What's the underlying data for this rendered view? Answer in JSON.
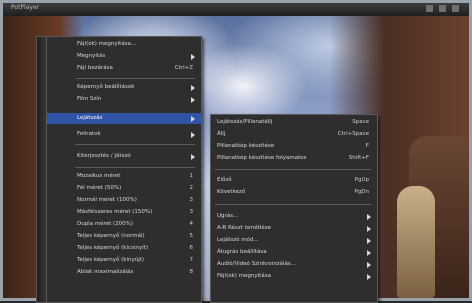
{
  "window": {
    "title": "PotPlayer"
  },
  "main_menu": {
    "items": [
      {
        "label": "Fájl(ok) megnyitása...",
        "key": "",
        "arrow": false
      },
      {
        "label": "Megnyitás",
        "key": "",
        "arrow": true
      },
      {
        "label": "Fájl bezárása",
        "key": "Ctrl+Z",
        "arrow": false
      },
      {
        "label": "Képernyő beállítások",
        "key": "",
        "arrow": true
      },
      {
        "label": "Film Szín",
        "key": "",
        "arrow": true
      },
      {
        "label": "Lejátszás",
        "key": "",
        "arrow": true
      },
      {
        "label": "Feliratok",
        "key": "",
        "arrow": true
      },
      {
        "label": "Kiterjesztés / Játszó",
        "key": "",
        "arrow": true
      },
      {
        "label": "Mozaikus méret",
        "key": "1",
        "arrow": false
      },
      {
        "label": "Fél méret (50%)",
        "key": "2",
        "arrow": false
      },
      {
        "label": "Normál méret (100%)",
        "key": "3",
        "arrow": false
      },
      {
        "label": "Másfélszeres méret (150%)",
        "key": "3",
        "arrow": false
      },
      {
        "label": "Dupla méret (200%)",
        "key": "4",
        "arrow": false
      },
      {
        "label": "Teljes képernyő (normál)",
        "key": "5",
        "arrow": false
      },
      {
        "label": "Teljes képernyő (kicsinyít)",
        "key": "6",
        "arrow": false
      },
      {
        "label": "Teljes képernyő (kinyújt)",
        "key": "7",
        "arrow": false
      },
      {
        "label": "Ablak maximalizálás",
        "key": "8",
        "arrow": false
      }
    ]
  },
  "sub_menu": {
    "items": [
      {
        "label": "Lejátszás/Pillanatállj",
        "key": "Space",
        "arrow": false
      },
      {
        "label": "Állj",
        "key": "Ctrl+Space",
        "arrow": false
      },
      {
        "label": "Pillanatkép készítése",
        "key": "F",
        "arrow": false
      },
      {
        "label": "Pillanatkép készítése folyamatos",
        "key": "Shift+F",
        "arrow": false
      },
      {
        "label": "Előző",
        "key": "PgUp",
        "arrow": false
      },
      {
        "label": "Következő",
        "key": "PgDn",
        "arrow": false
      },
      {
        "label": "Ugrás...",
        "key": "",
        "arrow": true
      },
      {
        "label": "A-B Részt ismétlése",
        "key": "",
        "arrow": true
      },
      {
        "label": "Lejátszó mód...",
        "key": "",
        "arrow": true
      },
      {
        "label": "Átugrás beállítása",
        "key": "",
        "arrow": true
      },
      {
        "label": "Audió/Videó Szinkronizálás...",
        "key": "",
        "arrow": true
      },
      {
        "label": "Fájl(ok) megnyitása",
        "key": "",
        "arrow": true
      }
    ]
  }
}
